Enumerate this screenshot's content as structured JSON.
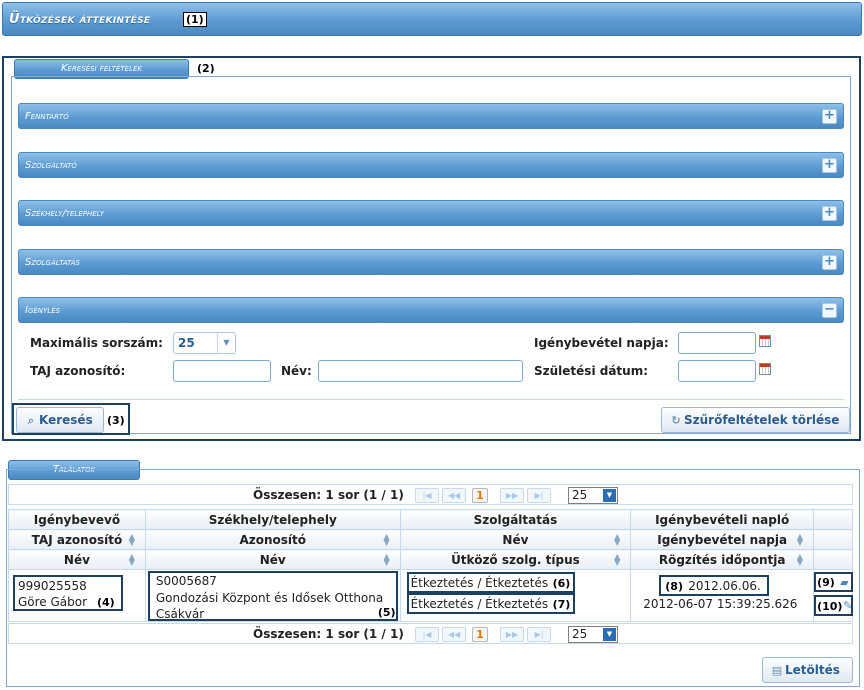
{
  "header": {
    "title": "Ütközések áttekintése",
    "marker": "(1)"
  },
  "search": {
    "legend": "Keresési feltételek",
    "marker": "(2)",
    "sections": [
      "Fenntartó",
      "Szolgáltató",
      "Székhely/telephely",
      "Szolgáltatás",
      "Igénylés"
    ],
    "expanded_section": "Igénylés",
    "fields": {
      "max_label": "Maximális sorszám:",
      "max_value": "25",
      "taj_label": "TAJ azonosító:",
      "nev_label": "Név:",
      "ig_napja_label": "Igénybevétel napja:",
      "szul_label": "Születési dátum:"
    },
    "search_button": "Keresés",
    "search_marker": "(3)",
    "clear_button": "Szűrőfeltételek törlése"
  },
  "results": {
    "legend": "Találatok",
    "pager": {
      "summary": "Összesen: 1 sor (1 / 1)",
      "page": "1",
      "page_size": "25"
    },
    "group_headers": [
      "Igénybevevő",
      "Székhely/telephely",
      "Szolgáltatás",
      "Igénybevételi napló"
    ],
    "sub_headers_1": [
      "TAJ azonosító",
      "Azonosító",
      "Név",
      "Igénybevétel napja"
    ],
    "sub_headers_2": [
      "Név",
      "Név",
      "Ütköző szolg. típus",
      "Rögzítés időpontja"
    ],
    "row": {
      "taj": "999025558",
      "name": "Göre Gábor",
      "marker4": "(4)",
      "site_id": "S0005687",
      "site_name": "Gondozási Központ és Idősek Otthona Csákvár",
      "marker5": "(5)",
      "service_name": "Étkeztetés / Étkeztetés",
      "marker6": "(6)",
      "conflict_type": "Étkeztetés / Étkeztetés",
      "marker7": "(7)",
      "date": "2012.06.06.",
      "marker8": "(8)",
      "recorded": "2012-06-07 15:39:25.626",
      "marker9": "(9)",
      "marker10": "(10)"
    },
    "download_button": "Letöltés"
  },
  "colors": {
    "accent": "#5d9bd2",
    "border_dark": "#1d3f60",
    "current_page": "#e07b00"
  }
}
